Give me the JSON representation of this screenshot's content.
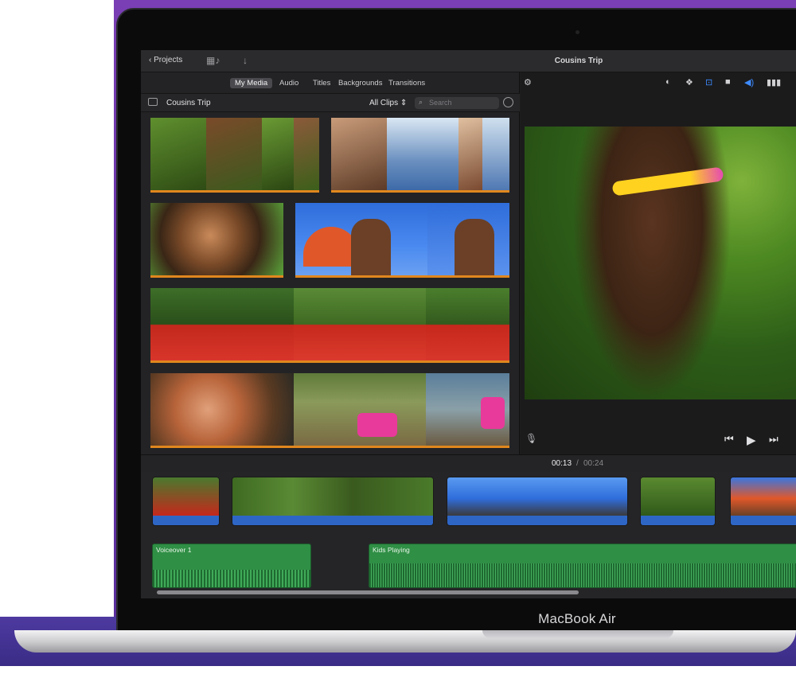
{
  "window": {
    "title": "Cousins Trip"
  },
  "toolbar": {
    "projects_label": "Projects",
    "media_icon": "media-import-icon",
    "download_icon": "arrow-down-icon"
  },
  "browser_tabs": [
    {
      "label": "My Media",
      "active": true
    },
    {
      "label": "Audio",
      "active": false
    },
    {
      "label": "Titles",
      "active": false
    },
    {
      "label": "Backgrounds",
      "active": false
    },
    {
      "label": "Transitions",
      "active": false
    }
  ],
  "library": {
    "title": "Cousins Trip",
    "filter": "All Clips",
    "search_placeholder": "Search"
  },
  "viewer_tools": [
    "magic-wand-icon",
    "color-balance-icon",
    "color-correction-icon",
    "crop-icon",
    "stabilization-icon",
    "volume-icon",
    "equalizer-icon"
  ],
  "playhead": {
    "current": "00:13",
    "separator": "/",
    "total": "00:24"
  },
  "audio_clips": [
    {
      "label": "Voiceover 1"
    },
    {
      "label": "Kids Playing"
    }
  ],
  "device": {
    "label": "MacBook Air"
  },
  "colors": {
    "accent_orange": "#e0871e",
    "audio_green": "#2f8f45",
    "video_blue": "#2e66c6",
    "brand_purple": "#6533a8"
  }
}
